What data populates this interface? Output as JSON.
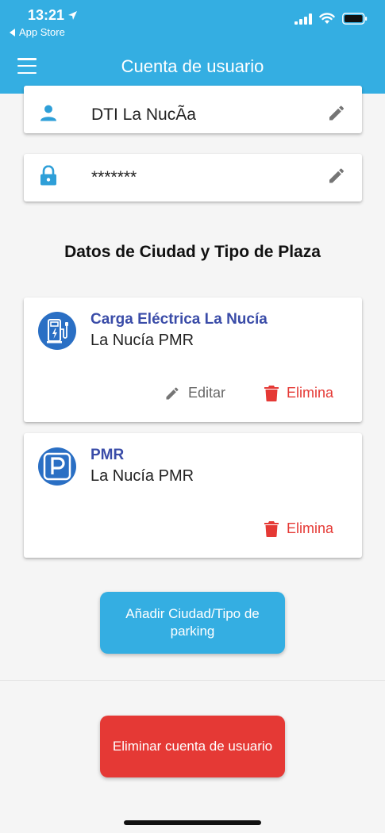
{
  "status_bar": {
    "time": "13:21",
    "back_app": "App Store"
  },
  "appbar": {
    "title": "Cuenta de usuario"
  },
  "account_fields": [
    {
      "value": "DTI La NucÃa",
      "icon": "person-icon"
    },
    {
      "value": "*******",
      "icon": "lock-icon"
    }
  ],
  "section": {
    "title": "Datos de Ciudad y Tipo de Plaza"
  },
  "places": [
    {
      "title": "Carga Eléctrica La Nucía",
      "subtitle": "La Nucía PMR",
      "icon": "ev-charging-icon",
      "edit_label": "Editar",
      "delete_label": "Elimina"
    },
    {
      "title": "PMR",
      "subtitle": "La Nucía PMR",
      "icon": "parking-icon",
      "delete_label": "Elimina"
    }
  ],
  "buttons": {
    "add_label": "Añadir Ciudad/Tipo de parking",
    "delete_account_label": "Eliminar cuenta de usuario"
  },
  "colors": {
    "primary": "#34aee2",
    "danger": "#e53935",
    "title_blue": "#3a4ca8",
    "icon_blue": "#2a6fc4"
  }
}
